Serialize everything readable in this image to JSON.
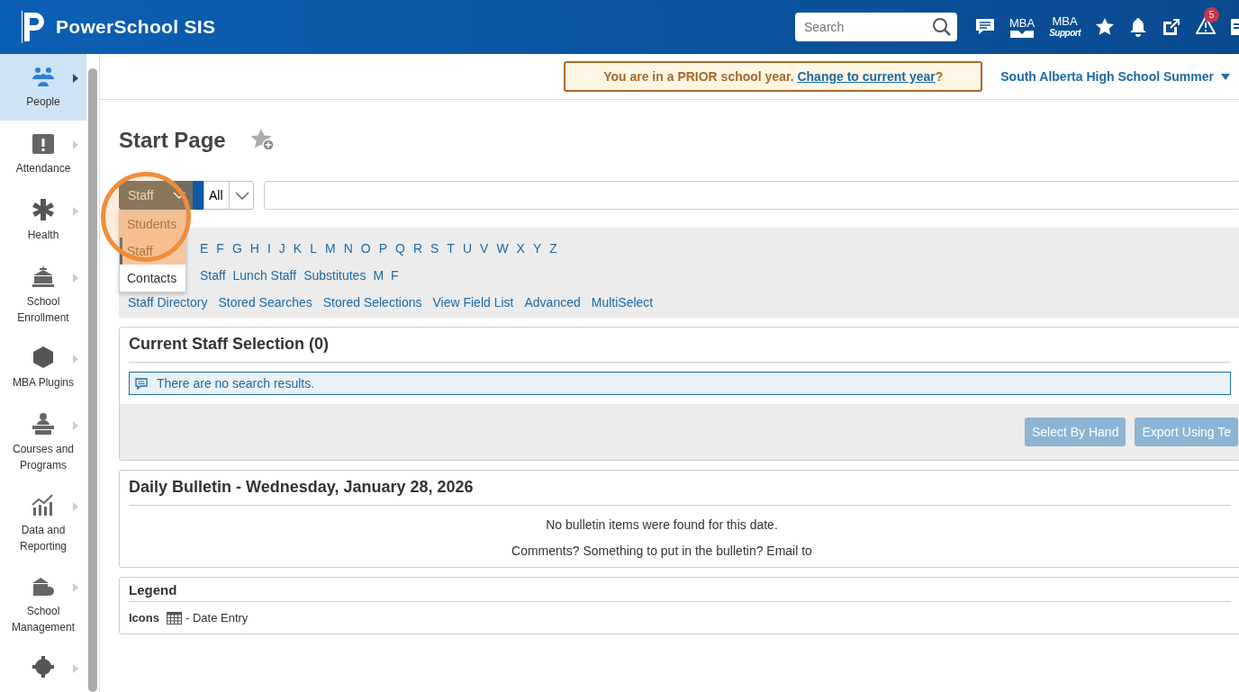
{
  "header": {
    "app_name": "PowerSchool SIS",
    "search": {
      "placeholder": "Search"
    },
    "mba_label": "MBA",
    "mba_support_label": "MBA",
    "mba_support_sub": "Support",
    "alert_count": "5"
  },
  "sidebar": {
    "items": [
      {
        "label": "People",
        "selected": true
      },
      {
        "label": "Attendance",
        "selected": false
      },
      {
        "label": "Health",
        "selected": false
      },
      {
        "label": "School Enrollment",
        "selected": false
      },
      {
        "label": "MBA Plugins",
        "selected": false
      },
      {
        "label": "Courses and Programs",
        "selected": false
      },
      {
        "label": "Data and Reporting",
        "selected": false
      },
      {
        "label": "School Management",
        "selected": false
      },
      {
        "selected": false
      }
    ]
  },
  "notice": {
    "text": "You are in a PRIOR school year.",
    "link": "Change to current year",
    "suffix": "?"
  },
  "school": "South Alberta High School Summer",
  "page_title": "Start Page",
  "search_bar": {
    "type_select": "Staff",
    "scope_select": "All",
    "dropdown_open": true,
    "options": [
      {
        "label": "Students",
        "selected": false,
        "highlighted": true
      },
      {
        "label": "Staff",
        "selected": true,
        "highlighted": true
      },
      {
        "label": "Contacts",
        "selected": false,
        "highlighted": false
      }
    ]
  },
  "letters": [
    "E",
    "F",
    "G",
    "H",
    "I",
    "J",
    "K",
    "L",
    "M",
    "N",
    "O",
    "P",
    "Q",
    "R",
    "S",
    "T",
    "U",
    "V",
    "W",
    "X",
    "Y",
    "Z"
  ],
  "quick_links": [
    "Staff",
    "Lunch Staff",
    "Substitutes",
    "M",
    "F"
  ],
  "tools": [
    "Staff Directory",
    "Stored Searches",
    "Stored Selections",
    "View Field List",
    "Advanced",
    "MultiSelect"
  ],
  "selection": {
    "title": "Current Staff Selection (0)",
    "message": "There are no search results.",
    "buttons": [
      "Select By Hand",
      "Export Using Te"
    ]
  },
  "bulletin": {
    "title": "Daily Bulletin - Wednesday, January 28, 2026",
    "lines": [
      "No bulletin items were found for this date.",
      "Comments? Something to put in the bulletin? Email to"
    ]
  },
  "legend": {
    "title": "Legend",
    "label": "Icons",
    "entry": "- Date Entry"
  }
}
